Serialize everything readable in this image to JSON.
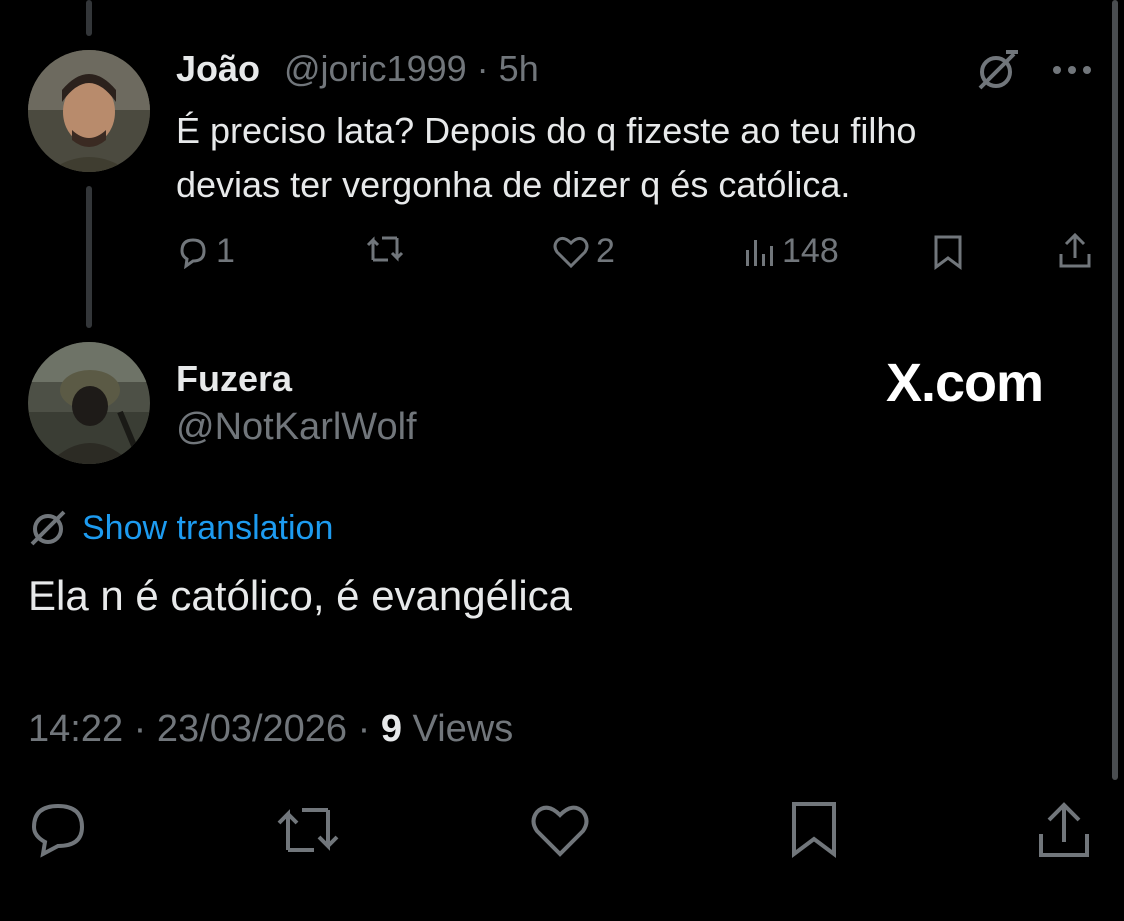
{
  "parent_tweet": {
    "author_name": "João",
    "handle": "@joric1999",
    "separator": "·",
    "time": "5h",
    "text_line1": "É preciso lata? Depois do q fizeste ao teu filho",
    "text_line2": "devias ter vergonha de dizer q és católica.",
    "replies": "1",
    "retweets": "",
    "likes": "2",
    "views": "148"
  },
  "reply_tweet": {
    "author_name": "Fuzera",
    "handle": "@NotKarlWolf",
    "translate_label": "Show translation",
    "text": "Ela n é católico, é evangélica",
    "time": "14:22",
    "date": "23/03/2026",
    "separator": "·",
    "views_count": "9",
    "views_label": "Views"
  },
  "watermark": "X.com",
  "colors": {
    "background": "#000000",
    "text": "#e7e9ea",
    "muted": "#71767b",
    "accent": "#1d9bf0"
  },
  "icons": [
    "no-translation-icon",
    "more-icon",
    "reply-icon",
    "retweet-icon",
    "like-icon",
    "views-icon",
    "bookmark-icon",
    "share-icon"
  ]
}
